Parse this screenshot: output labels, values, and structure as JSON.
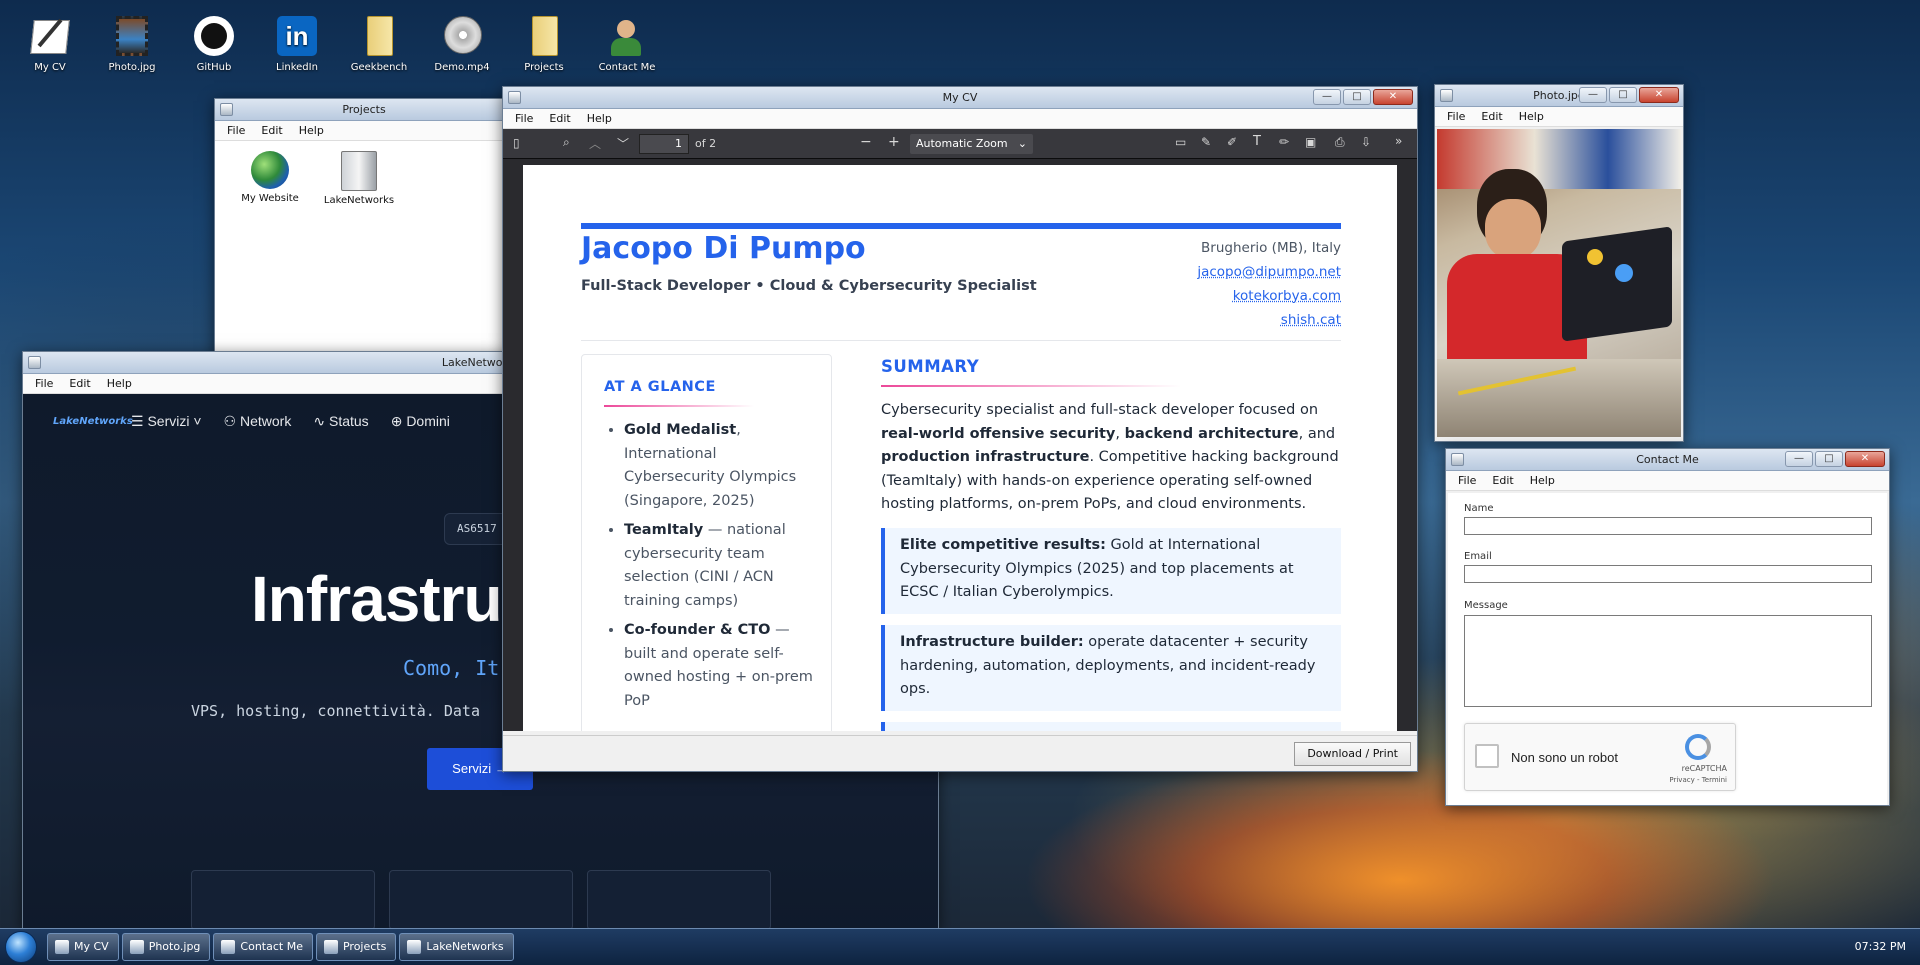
{
  "desktop": {
    "icons": [
      {
        "label": "My CV",
        "icon": "notepad-pen-icon"
      },
      {
        "label": "Photo.jpg",
        "icon": "film-photo-icon"
      },
      {
        "label": "GitHub",
        "icon": "github-icon"
      },
      {
        "label": "LinkedIn",
        "icon": "linkedin-icon"
      },
      {
        "label": "Geekbench",
        "icon": "folder-icon"
      },
      {
        "label": "Demo.mp4",
        "icon": "vcd-disc-icon"
      },
      {
        "label": "Projects",
        "icon": "folder-icon"
      },
      {
        "label": "Contact Me",
        "icon": "contact-icon"
      }
    ]
  },
  "menu": {
    "file": "File",
    "edit": "Edit",
    "help": "Help"
  },
  "projects": {
    "title": "Projects",
    "items": [
      {
        "label": "My Website",
        "icon": "globe-icon"
      },
      {
        "label": "LakeNetworks",
        "icon": "server-icon"
      }
    ]
  },
  "lakenetworks": {
    "title": "LakeNetworks",
    "logo": "LakeNetworks",
    "nav": [
      "Servizi",
      "Network",
      "Status",
      "Domini"
    ],
    "asn": "AS6517",
    "hero": "Infrastru",
    "location": "Como, It",
    "tagline": "VPS, hosting, connettività. Data",
    "cta": "Servizi",
    "cards": [
      "",
      "",
      ""
    ]
  },
  "cv": {
    "title": "My CV",
    "page": "1",
    "page_total": "of 2",
    "zoom": "Automatic Zoom",
    "download": "Download / Print",
    "name": "Jacopo Di Pumpo",
    "role": "Full-Stack Developer • Cloud & Cybersecurity Specialist",
    "contact": {
      "location": "Brugherio (MB), Italy",
      "email": "jacopo@dipumpo.net",
      "site1": "kotekorbya.com",
      "site2": "shish.cat"
    },
    "glance": {
      "heading": "AT A GLANCE",
      "items": [
        {
          "bold": "Gold Medalist",
          "text": ", International Cybersecurity Olympics (Singapore, 2025)"
        },
        {
          "bold": "TeamItaly",
          "text": " — national cybersecurity team selection (CINI / ACN training camps)"
        },
        {
          "bold": "Co-founder & CTO",
          "text": " — built and operate self-owned hosting + on-prem PoP"
        }
      ]
    },
    "summary": {
      "heading": "SUMMARY",
      "p1": "Cybersecurity specialist and full-stack developer focused on ",
      "b1": "real-world offensive security",
      "p2": ", ",
      "b2": "backend architecture",
      "p3": ", and ",
      "b3": "production infrastructure",
      "p4": ". Competitive hacking background (TeamItaly) with hands-on experience operating self-owned hosting platforms, on-prem PoPs, and cloud environments.",
      "box1_bold": "Elite competitive results:",
      "box1_text": " Gold at International Cybersecurity Olympics (2025) and top placements at ECSC / Italian Cyberolympics.",
      "box2_bold": "Infrastructure builder:",
      "box2_text": " operate datacenter + security hardening, automation, deployments, and incident-ready ops."
    }
  },
  "photo": {
    "title": "Photo.jpg"
  },
  "contact": {
    "title": "Contact Me",
    "name_label": "Name",
    "email_label": "Email",
    "message_label": "Message",
    "captcha_label": "Non sono un robot",
    "captcha_brand": "reCAPTCHA",
    "captcha_links": "Privacy - Termini"
  },
  "taskbar": {
    "items": [
      "My CV",
      "Photo.jpg",
      "Contact Me",
      "Projects",
      "LakeNetworks"
    ],
    "clock": "07:32 PM"
  },
  "colors": {
    "cv_accent": "#2563eb",
    "lake_bg": "#0f1a2b",
    "lake_button": "#1d4ed8",
    "lake_blue_text": "#60a5fa"
  }
}
